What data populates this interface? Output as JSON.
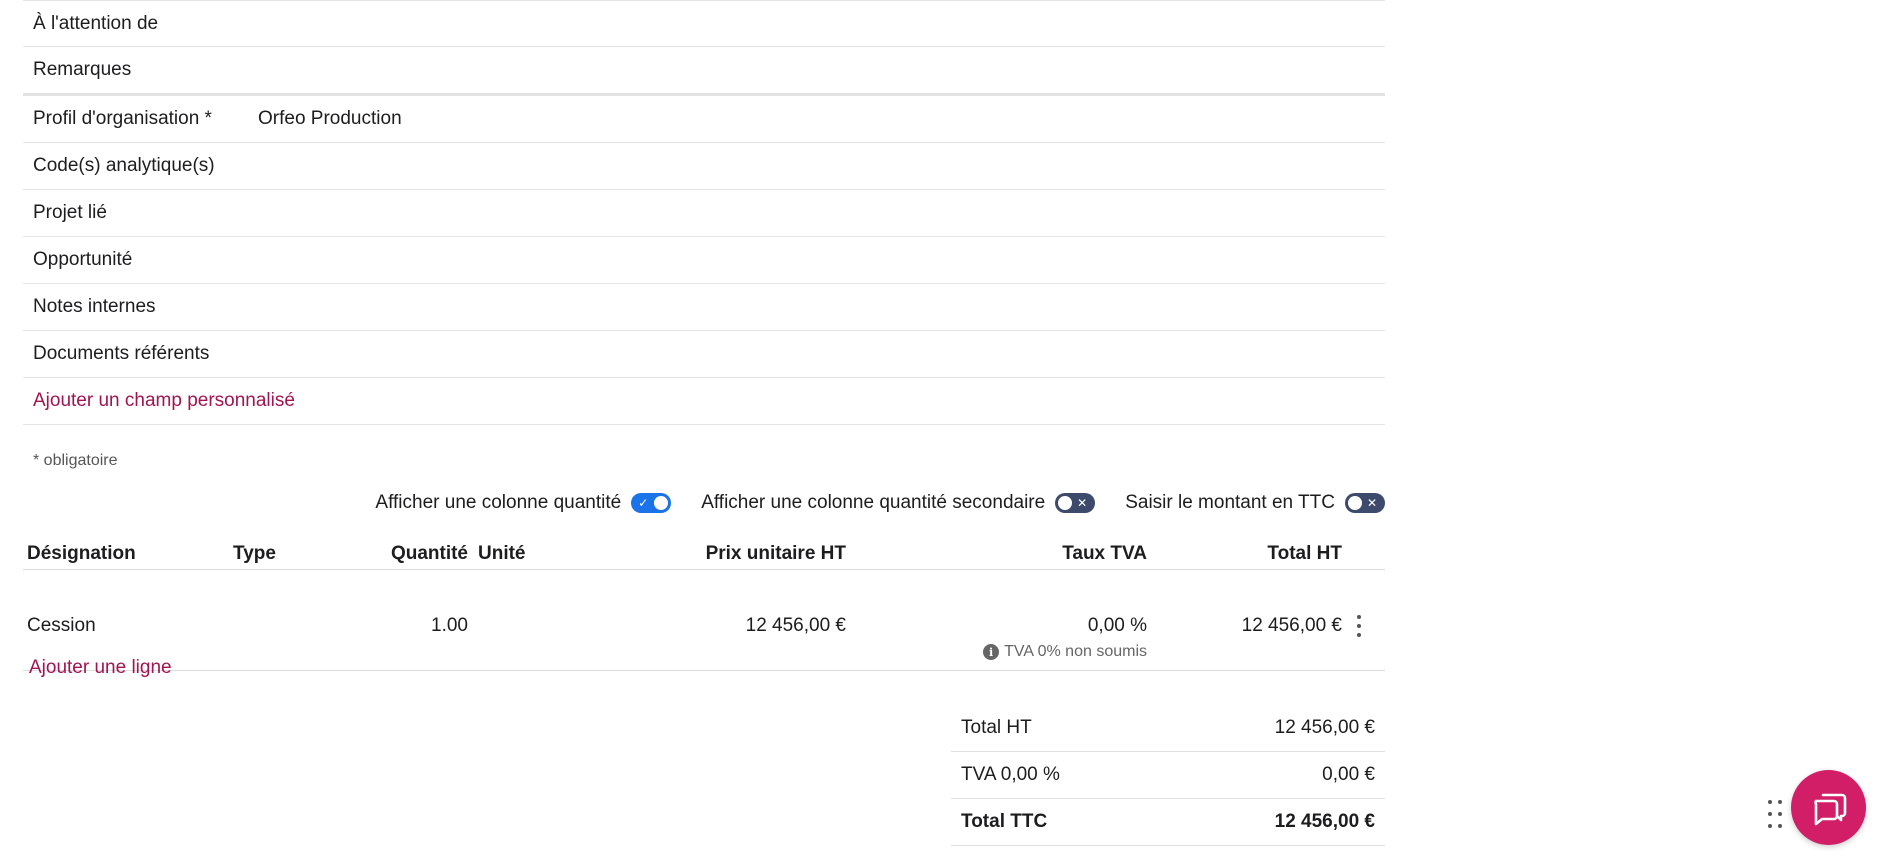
{
  "fields": [
    {
      "label": "À l'attention de",
      "value": ""
    },
    {
      "label": "Remarques",
      "value": ""
    },
    {
      "label": "Profil d'organisation *",
      "value": "Orfeo Production"
    },
    {
      "label": "Code(s) analytique(s)",
      "value": ""
    },
    {
      "label": "Projet lié",
      "value": ""
    },
    {
      "label": "Opportunité",
      "value": ""
    },
    {
      "label": "Notes internes",
      "value": ""
    },
    {
      "label": "Documents référents",
      "value": ""
    }
  ],
  "add_custom_field": "Ajouter un champ personnalisé",
  "required_note": "* obligatoire",
  "toggles": [
    {
      "label": "Afficher une colonne quantité",
      "state": "on"
    },
    {
      "label": "Afficher une colonne quantité secondaire",
      "state": "off"
    },
    {
      "label": "Saisir le montant en TTC",
      "state": "off"
    }
  ],
  "table": {
    "headers": {
      "designation": "Désignation",
      "type": "Type",
      "quantity": "Quantité",
      "unit": "Unité",
      "unit_price": "Prix unitaire HT",
      "vat_rate": "Taux TVA",
      "total": "Total HT"
    },
    "rows": [
      {
        "designation": "Cession",
        "type": "",
        "quantity": "1.00",
        "unit": "",
        "unit_price": "12 456,00 €",
        "vat_rate": "0,00 %",
        "total": "12 456,00 €",
        "vat_note": "TVA 0% non soumis"
      }
    ]
  },
  "add_line": "Ajouter une ligne",
  "totals": [
    {
      "label": "Total HT",
      "value": "12 456,00 €"
    },
    {
      "label": "TVA 0,00 %",
      "value": "0,00 €"
    },
    {
      "label": "Total TTC",
      "value": "12 456,00 €"
    }
  ],
  "colors": {
    "accent": "#a01451",
    "fab": "#d11e66",
    "toggle_on": "#1a73e8",
    "toggle_off": "#3d4a6b"
  },
  "icons": {
    "fab": "chat-icon",
    "vat_info": "info-icon",
    "row_menu": "more-vertical-icon",
    "drag": "drag-handle-icon"
  }
}
